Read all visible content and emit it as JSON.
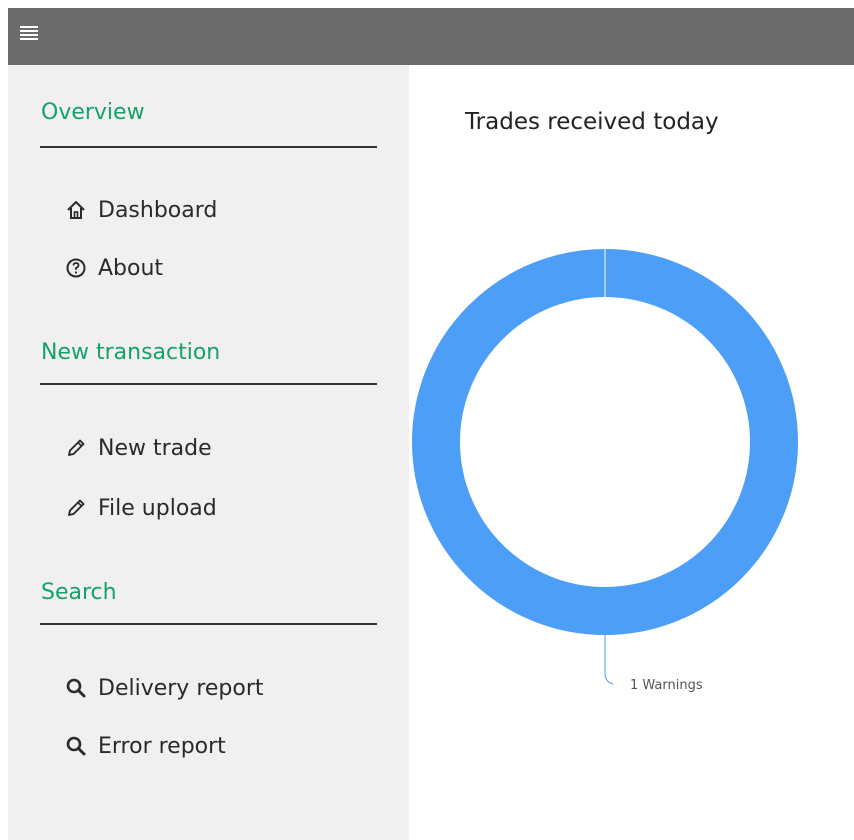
{
  "header": {
    "menu_icon": "hamburger-icon"
  },
  "sidebar": {
    "sections": [
      {
        "title": "Overview",
        "items": [
          {
            "label": "Dashboard",
            "icon": "home-icon"
          },
          {
            "label": "About",
            "icon": "help-circle-icon"
          }
        ]
      },
      {
        "title": "New transaction",
        "items": [
          {
            "label": "New trade",
            "icon": "pencil-icon"
          },
          {
            "label": "File upload",
            "icon": "pencil-icon"
          }
        ]
      },
      {
        "title": "Search",
        "items": [
          {
            "label": "Delivery report",
            "icon": "search-icon"
          },
          {
            "label": "Error report",
            "icon": "search-icon"
          }
        ]
      }
    ]
  },
  "main": {
    "title": "Trades received today"
  },
  "chart_data": {
    "type": "pie",
    "title": "Trades received today",
    "slices": [
      {
        "label": "1 Warnings",
        "value": 1
      }
    ],
    "donut": true,
    "colors": [
      "#4d9ef6"
    ]
  }
}
